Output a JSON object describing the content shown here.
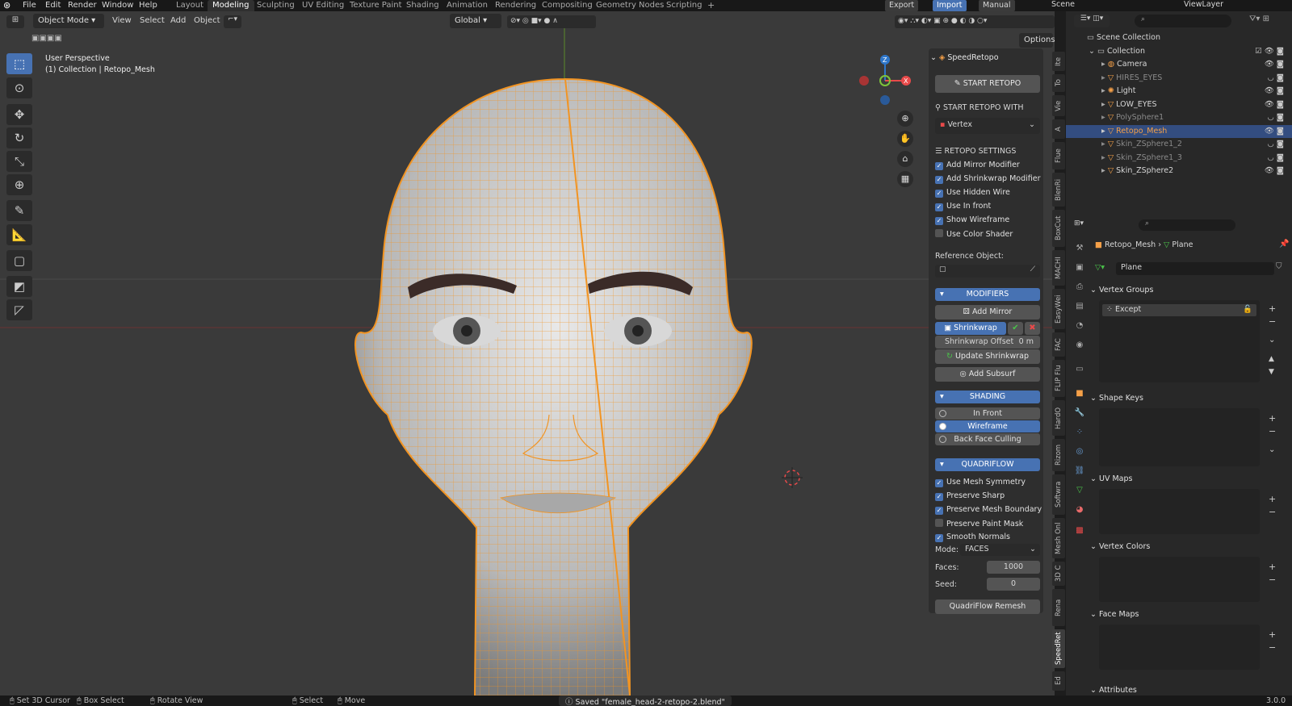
{
  "menus": [
    "File",
    "Edit",
    "Render",
    "Window",
    "Help"
  ],
  "workspaces": [
    "Layout",
    "Modeling",
    "Sculpting",
    "UV Editing",
    "Texture Paint",
    "Shading",
    "Animation",
    "Rendering",
    "Compositing",
    "Geometry Nodes",
    "Scripting"
  ],
  "active_workspace": "Modeling",
  "topright": {
    "export": "Export",
    "import": "Import",
    "manual": "Manual",
    "scene": "Scene",
    "view_layer": "ViewLayer"
  },
  "vp_header": {
    "mode": "Object Mode",
    "view": "View",
    "select": "Select",
    "add": "Add",
    "object": "Object",
    "transform": "Global",
    "options": "Options"
  },
  "viewport": {
    "perspective": "User Perspective",
    "collection": "(1) Collection | Retopo_Mesh"
  },
  "npanel": {
    "title": "SpeedRetopo",
    "start_retopo": "START RETOPO",
    "start_with_label": "START RETOPO WITH",
    "start_with_value": "Vertex",
    "settings_label": "RETOPO SETTINGS",
    "settings": [
      {
        "label": "Add Mirror Modifier",
        "checked": true
      },
      {
        "label": "Add Shrinkwrap Modifier",
        "checked": true
      },
      {
        "label": "Use Hidden Wire",
        "checked": true
      },
      {
        "label": "Use In front",
        "checked": true
      },
      {
        "label": "Show Wireframe",
        "checked": true
      },
      {
        "label": "Use Color Shader",
        "checked": false
      }
    ],
    "reference_label": "Reference Object:",
    "modifiers_label": "MODIFIERS",
    "add_mirror": "Add Mirror",
    "shrinkwrap": "Shrinkwrap",
    "shrink_offset_label": "Shrinkwrap Offset",
    "shrink_offset_value": "0 m",
    "update_shrinkwrap": "Update Shrinkwrap",
    "add_subsurf": "Add Subsurf",
    "shading_label": "SHADING",
    "shading": [
      {
        "label": "In Front",
        "selected": false
      },
      {
        "label": "Wireframe",
        "selected": true
      },
      {
        "label": "Back Face Culling",
        "selected": false
      }
    ],
    "quadriflow_label": "QUADRIFLOW",
    "quadriflow": [
      {
        "label": "Use Mesh Symmetry",
        "checked": true
      },
      {
        "label": "Preserve Sharp",
        "checked": true
      },
      {
        "label": "Preserve Mesh Boundary",
        "checked": true
      },
      {
        "label": "Preserve Paint Mask",
        "checked": false
      },
      {
        "label": "Smooth Normals",
        "checked": true
      }
    ],
    "mode_label": "Mode:",
    "mode_value": "FACES",
    "faces_label": "Faces:",
    "faces_value": "1000",
    "seed_label": "Seed:",
    "seed_value": "0",
    "remesh": "QuadriFlow Remesh"
  },
  "vtabs": [
    "Ite",
    "To",
    "Vie",
    "A",
    "Flue",
    "BlenRi",
    "BoxCut",
    "MACHI",
    "EasyWei",
    "FAC",
    "FLIP Flu",
    "HardO",
    "Rizom",
    "Softwra",
    "Mesh Onl",
    "3D C",
    "Rena",
    "SpeedRet",
    "Ed"
  ],
  "outliner": {
    "root": "Scene Collection",
    "collection": "Collection",
    "items": [
      {
        "name": "Camera",
        "dim": false
      },
      {
        "name": "HIRES_EYES",
        "dim": true
      },
      {
        "name": "Light",
        "dim": false
      },
      {
        "name": "LOW_EYES",
        "dim": false
      },
      {
        "name": "PolySphere1",
        "dim": true
      },
      {
        "name": "Retopo_Mesh",
        "dim": false,
        "selected": true
      },
      {
        "name": "Skin_ZSphere1_2",
        "dim": true
      },
      {
        "name": "Skin_ZSphere1_3",
        "dim": true
      },
      {
        "name": "Skin_ZSphere2",
        "dim": false
      }
    ]
  },
  "properties": {
    "object": "Retopo_Mesh",
    "data": "Plane",
    "data_field": "Plane",
    "vertex_groups": "Vertex Groups",
    "vg_item": "Except",
    "shape_keys": "Shape Keys",
    "uv_maps": "UV Maps",
    "vertex_colors": "Vertex Colors",
    "face_maps": "Face Maps",
    "attributes": "Attributes"
  },
  "status": {
    "set_cursor": "Set 3D Cursor",
    "box_select": "Box Select",
    "rotate_view": "Rotate View",
    "select": "Select",
    "move": "Move",
    "saved": "Saved \"female_head-2-retopo-2.blend\"",
    "version": "3.0.0"
  },
  "colors": {
    "accent": "#4772b3",
    "wire": "#f29422",
    "selected_row": "#334d80"
  }
}
